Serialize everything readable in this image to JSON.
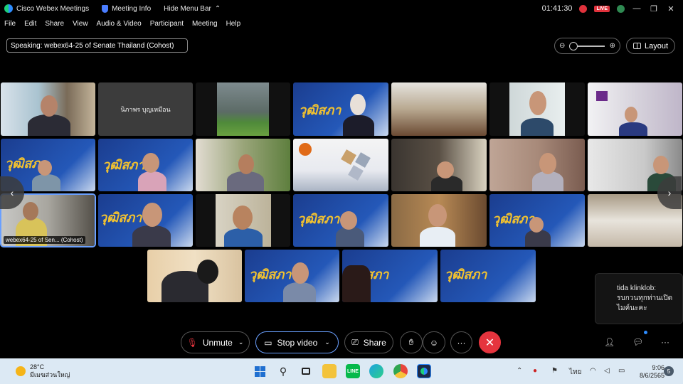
{
  "titlebar": {
    "app_name": "Cisco Webex Meetings",
    "meeting_info": "Meeting Info",
    "hide_menu": "Hide Menu Bar",
    "time": "01:41:30",
    "live": "LIVE"
  },
  "menu": [
    "File",
    "Edit",
    "Share",
    "View",
    "Audio & Video",
    "Participant",
    "Meeting",
    "Help"
  ],
  "speaking": "Speaking: webex64-25 of Senate Thailand (Cohost)",
  "layout_label": "Layout",
  "tiles": {
    "name_tile": "นิภาพร บุญเหมือน",
    "active_label": "webex64-25 of Sen... (Cohost)",
    "banner_text": "วุฒิสภา"
  },
  "chat": {
    "sender": "tida klinklob:",
    "line1": "รบกวนทุกท่านเปิด",
    "line2": "ไมค์นะคะ"
  },
  "controls": {
    "unmute": "Unmute",
    "stop_video": "Stop video",
    "share": "Share"
  },
  "taskbar": {
    "temp": "28°C",
    "weather_desc": "มีเมฆส่วนใหญ่",
    "lang": "ไทย",
    "clock_time": "9:06",
    "clock_date": "8/6/2565",
    "notif_count": "5"
  },
  "colors": {
    "accent": "#2d8cff",
    "hangup": "#e5343e",
    "banner_blue": "#1b3d8f",
    "banner_gold": "#f2c230"
  }
}
